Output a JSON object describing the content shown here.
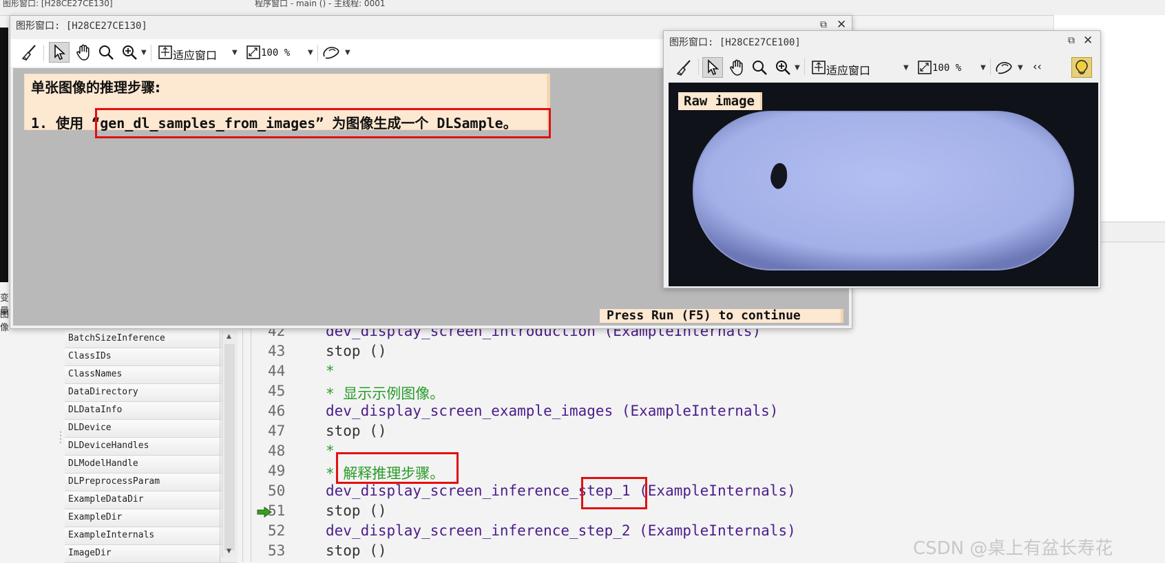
{
  "ide": {
    "top_left_text": "图形窗口: [H28CE27CE130]",
    "top_mid_text": "程序窗口 - main () - 主线程: 0001",
    "side_tab_1": "变量",
    "side_tab_2": "图像"
  },
  "variables": {
    "items": [
      "BatchSizeInference",
      "ClassIDs",
      "ClassNames",
      "DataDirectory",
      "DLDataInfo",
      "DLDevice",
      "DLDeviceHandles",
      "DLModelHandle",
      "DLPreprocessParam",
      "ExampleDataDir",
      "ExampleDir",
      "ExampleInternals",
      "ImageDir"
    ],
    "scroll_up": "▲",
    "scroll_down": "▼"
  },
  "editor": {
    "lines": [
      {
        "num": "42",
        "code": "dev_display_screen_introduction (ExampleInternals)",
        "kind": "proc"
      },
      {
        "num": "43",
        "code": "stop ()",
        "kind": "stmt"
      },
      {
        "num": "44",
        "code": "*",
        "kind": "comment"
      },
      {
        "num": "45",
        "code": "* 显示示例图像。",
        "kind": "comment"
      },
      {
        "num": "46",
        "code": "dev_display_screen_example_images (ExampleInternals)",
        "kind": "proc"
      },
      {
        "num": "47",
        "code": "stop ()",
        "kind": "stmt"
      },
      {
        "num": "48",
        "code": "*",
        "kind": "comment"
      },
      {
        "num": "49",
        "code": "* 解释推理步骤。",
        "kind": "comment"
      },
      {
        "num": "50",
        "code": "dev_display_screen_inference_step_1 (ExampleInternals)",
        "kind": "proc"
      },
      {
        "num": "51",
        "code": "stop ()",
        "kind": "stmt"
      },
      {
        "num": "52",
        "code": "dev_display_screen_inference_step_2 (ExampleInternals)",
        "kind": "proc"
      },
      {
        "num": "53",
        "code": "stop ()",
        "kind": "stmt"
      }
    ]
  },
  "graphics_window_1": {
    "title": "图形窗口: [H28CE27CE130]",
    "fit_label": "适应窗口",
    "zoom_label": "100 %",
    "note_title": "单张图像的推理步骤:",
    "note_step": "1. 使用 “gen_dl_samples_from_images” 为图像生成一个 DLSample。",
    "press_run": "Press Run (F5) to continue"
  },
  "graphics_window_2": {
    "title": "图形窗口: [H28CE27CE100]",
    "fit_label": "适应窗口",
    "zoom_label": "100 %",
    "more_label": "‹‹",
    "image_label": "Raw image"
  },
  "watermark": "CSDN @桌上有盆长寿花",
  "colors": {
    "note_bg": "#fde8d2",
    "highlight_red": "#e01010",
    "comment_green": "#2a9b2a",
    "proc_purple": "#4b1c8a",
    "pill_blue": "#a6b4ee"
  },
  "icons": [
    "broom-icon",
    "pointer-icon",
    "hand-icon",
    "magnifier-icon",
    "zoom-in-icon",
    "fit-window-icon",
    "zoom-level-icon",
    "region-shape-icon",
    "lightbulb-icon",
    "restore-icon",
    "close-icon",
    "execution-arrow-icon"
  ]
}
